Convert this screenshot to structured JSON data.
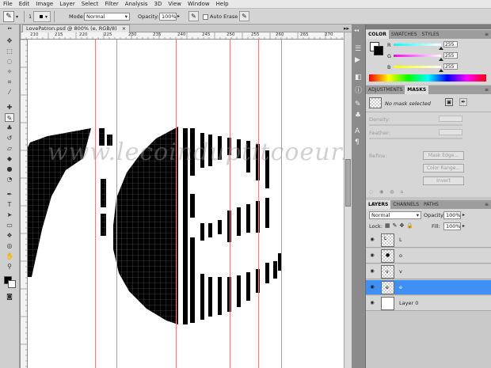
{
  "menu": [
    "File",
    "Edit",
    "Image",
    "Layer",
    "Select",
    "Filter",
    "Analysis",
    "3D",
    "View",
    "Window",
    "Help"
  ],
  "options": {
    "brush_size": "1",
    "mode_label": "Mode:",
    "mode_value": "Normal",
    "opacity_label": "Opacity:",
    "opacity_value": "100%",
    "auto_erase": "Auto Erase"
  },
  "document": {
    "tab_title": "LovePatron.psd @ 800% (e, RGB/8)",
    "ruler_labels": [
      "210",
      "215",
      "220",
      "225",
      "230",
      "235",
      "240",
      "245",
      "250",
      "255",
      "260",
      "265",
      "270"
    ]
  },
  "watermark": "www.lecoinduptitcoeur.fr",
  "color_panel": {
    "tabs": [
      "COLOR",
      "SWATCHES",
      "STYLES"
    ],
    "channels": [
      {
        "label": "R",
        "value": "255"
      },
      {
        "label": "G",
        "value": "255"
      },
      {
        "label": "B",
        "value": "255"
      }
    ]
  },
  "adjustments_panel": {
    "tabs": [
      "ADJUSTMENTS",
      "MASKS"
    ],
    "no_mask": "No mask selected",
    "density": "Density:",
    "feather": "Feather:",
    "refine": "Refine:",
    "mask_edge": "Mask Edge...",
    "color_range": "Color Range...",
    "invert": "Invert"
  },
  "layers_panel": {
    "tabs": [
      "LAYERS",
      "CHANNELS",
      "PATHS"
    ],
    "blend_mode": "Normal",
    "opacity_label": "Opacity:",
    "opacity_value": "100%",
    "lock_label": "Lock:",
    "fill_label": "Fill:",
    "fill_value": "100%",
    "layers": [
      {
        "name": "L",
        "selected": false
      },
      {
        "name": "o",
        "selected": false
      },
      {
        "name": "v",
        "selected": false
      },
      {
        "name": "e",
        "selected": true
      },
      {
        "name": "Layer 0",
        "selected": false
      }
    ]
  },
  "colors": {
    "selection": "#3f8ff5",
    "guide": "#f08080",
    "ink": "#000000"
  }
}
